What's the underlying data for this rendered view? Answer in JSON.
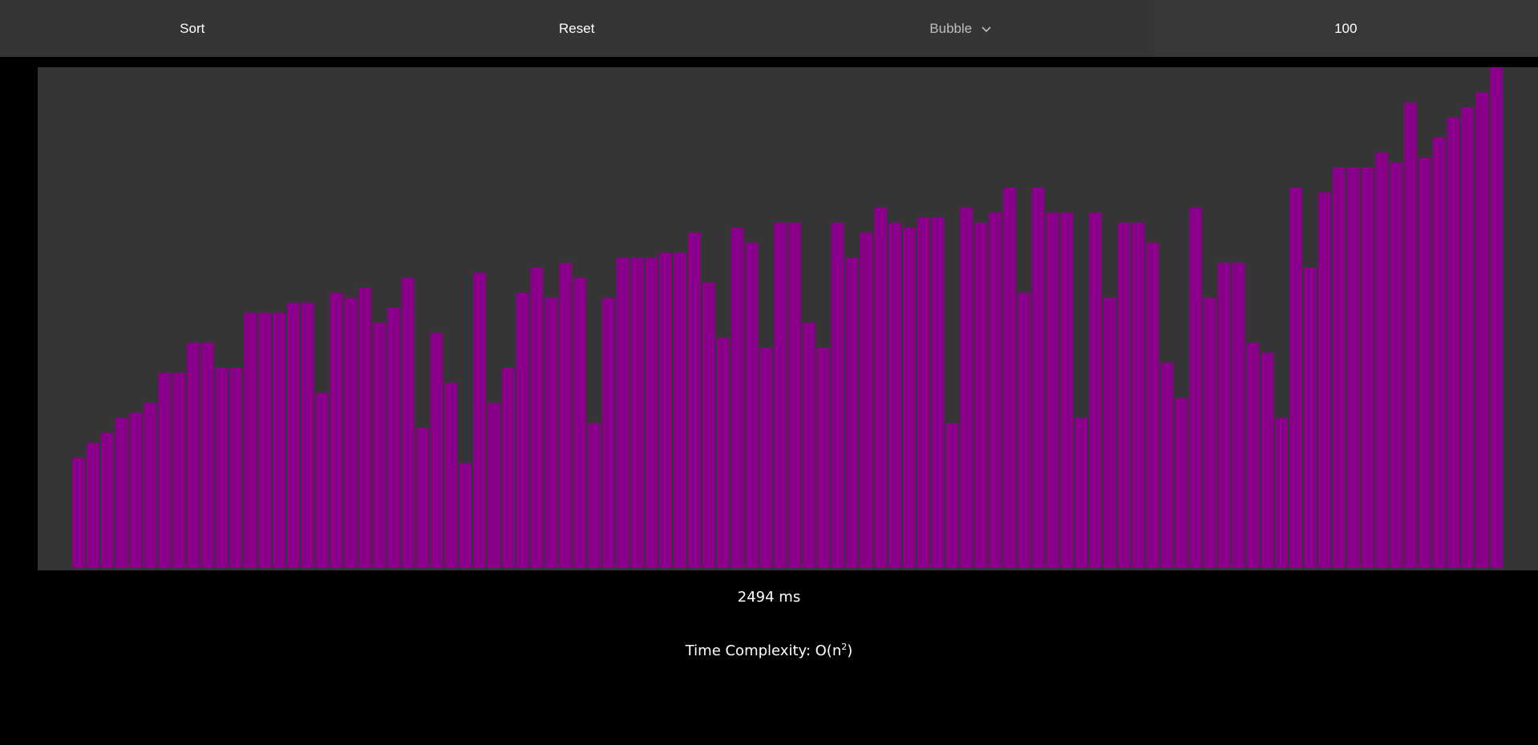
{
  "toolbar": {
    "sort_label": "Sort",
    "reset_label": "Reset",
    "algorithm_selected": "Bubble",
    "array_size": "100"
  },
  "footer": {
    "elapsed": "2494 ms",
    "complexity_prefix": "Time Complexity: O(n",
    "complexity_exponent": "2",
    "complexity_suffix": ")"
  },
  "colors": {
    "bar": "#8a008a",
    "panel": "#353535",
    "toolbar": "#353535",
    "background": "#000000"
  },
  "icons": {
    "algorithm_dropdown": "chevron-down-icon"
  },
  "chart_data": {
    "type": "bar",
    "title": "",
    "xlabel": "",
    "ylabel": "",
    "ylim": [
      0,
      100
    ],
    "values": [
      22,
      25,
      27,
      30,
      31,
      33,
      39,
      39,
      45,
      45,
      40,
      40,
      51,
      51,
      51,
      53,
      53,
      35,
      55,
      54,
      56,
      49,
      52,
      58,
      28,
      47,
      37,
      21,
      59,
      33,
      40,
      55,
      60,
      54,
      61,
      58,
      29,
      54,
      62,
      62,
      62,
      63,
      63,
      67,
      57,
      46,
      68,
      65,
      44,
      69,
      69,
      49,
      44,
      69,
      62,
      67,
      72,
      69,
      68,
      70,
      70,
      29,
      72,
      69,
      71,
      76,
      55,
      76,
      71,
      71,
      30,
      71,
      54,
      69,
      69,
      65,
      41,
      34,
      72,
      54,
      61,
      61,
      45,
      43,
      30,
      76,
      60,
      75,
      80,
      80,
      80,
      83,
      81,
      93,
      82,
      86,
      90,
      92,
      95,
      100
    ]
  }
}
